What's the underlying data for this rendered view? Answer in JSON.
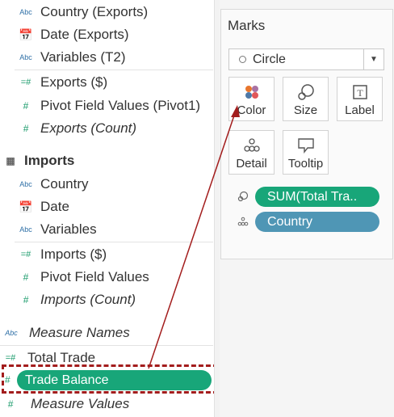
{
  "data_pane": {
    "exports_fields": [
      {
        "icon": "Abc",
        "label": "Country (Exports)"
      },
      {
        "icon": "date",
        "label": "Date (Exports)"
      },
      {
        "icon": "Abc",
        "label": "Variables (T2)"
      },
      {
        "icon": "=#",
        "label": "Exports ($)"
      },
      {
        "icon": "#",
        "label": "Pivot Field Values (Pivot1)"
      },
      {
        "icon": "#",
        "label": "Exports (Count)"
      }
    ],
    "imports_header": "Imports",
    "imports_fields": [
      {
        "icon": "Abc",
        "label": "Country"
      },
      {
        "icon": "date",
        "label": "Date"
      },
      {
        "icon": "Abc",
        "label": "Variables"
      },
      {
        "icon": "=#",
        "label": "Imports ($)"
      },
      {
        "icon": "#",
        "label": "Pivot Field Values"
      },
      {
        "icon": "#",
        "label": "Imports (Count)"
      }
    ],
    "measure_names": "Measure Names",
    "total_trade": "Total Trade",
    "trade_balance": "Trade Balance",
    "measure_values": "Measure Values"
  },
  "marks": {
    "title": "Marks",
    "mark_type": "Circle",
    "buttons": {
      "color": "Color",
      "size": "Size",
      "label": "Label",
      "detail": "Detail",
      "tooltip": "Tooltip"
    },
    "pills": {
      "size_pill": "SUM(Total Tra..",
      "detail_pill": "Country"
    }
  },
  "colors": {
    "green_pill": "#18a679",
    "blue_pill": "#4f96b5",
    "highlight": "#a31d1d"
  }
}
